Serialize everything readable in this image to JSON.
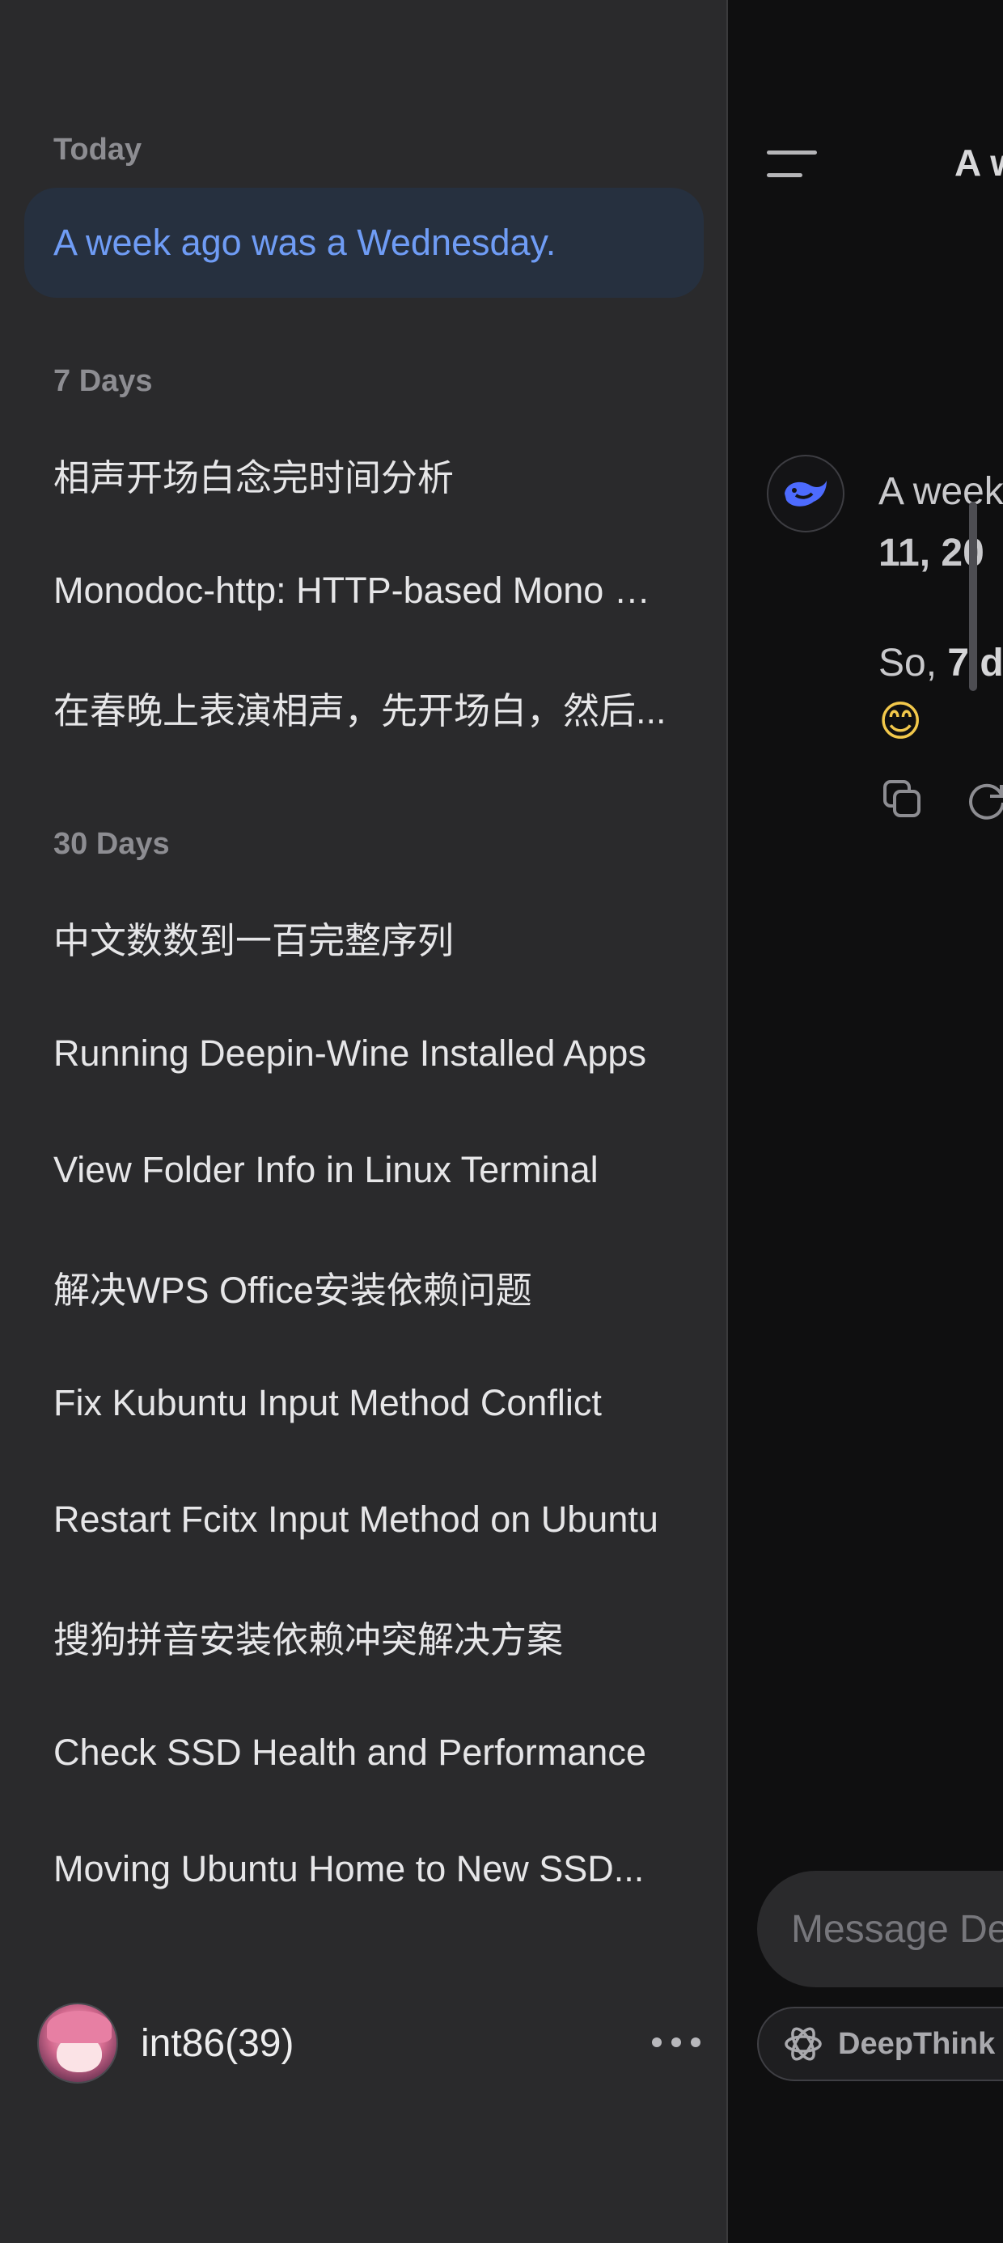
{
  "sidebar": {
    "sections": [
      {
        "label": "Today"
      },
      {
        "label": "7 Days"
      },
      {
        "label": "30 Days"
      }
    ],
    "today_items": [
      {
        "label": "A week ago was a Wednesday."
      }
    ],
    "seven_day_items": [
      {
        "label": "相声开场白念完时间分析"
      },
      {
        "label": "Monodoc-http: HTTP-based Mono Documentation"
      },
      {
        "label": "在春晚上表演相声，先开场白，然后..."
      }
    ],
    "thirty_day_items": [
      {
        "label": "中文数数到一百完整序列"
      },
      {
        "label": "Running Deepin-Wine Installed Apps"
      },
      {
        "label": "View Folder Info in Linux Terminal"
      },
      {
        "label": "解决WPS Office安装依赖问题"
      },
      {
        "label": "Fix Kubuntu Input Method Conflict"
      },
      {
        "label": "Restart Fcitx Input Method on Ubuntu"
      },
      {
        "label": "搜狗拼音安装依赖冲突解决方案"
      },
      {
        "label": "Check SSD Health and Performance"
      },
      {
        "label": "Moving Ubuntu Home to New SSD..."
      }
    ],
    "user": {
      "name": "int86(39)",
      "avatar_icon": "avatar-icon",
      "menu_icon": "more-horizontal-icon"
    }
  },
  "main": {
    "header_title": "A w",
    "menu_icon": "menu-icon",
    "message": {
      "logo_icon": "deepseek-whale-icon",
      "line1": "A week",
      "line2": "11, 20",
      "line3_prefix": "So, ",
      "line3_bold": "7 d",
      "emoji": "😊"
    },
    "actions": {
      "copy_icon": "copy-icon",
      "regenerate_icon": "refresh-icon"
    },
    "input_placeholder": "Message De",
    "deepthink_label": "DeepThink ("
  },
  "colors": {
    "sidebar_bg": "#2a2a2c",
    "main_bg": "#0f0f10",
    "active_item_bg": "#26303f",
    "active_item_text": "#6f9cf5",
    "brand_blue": "#4d6bfe"
  }
}
